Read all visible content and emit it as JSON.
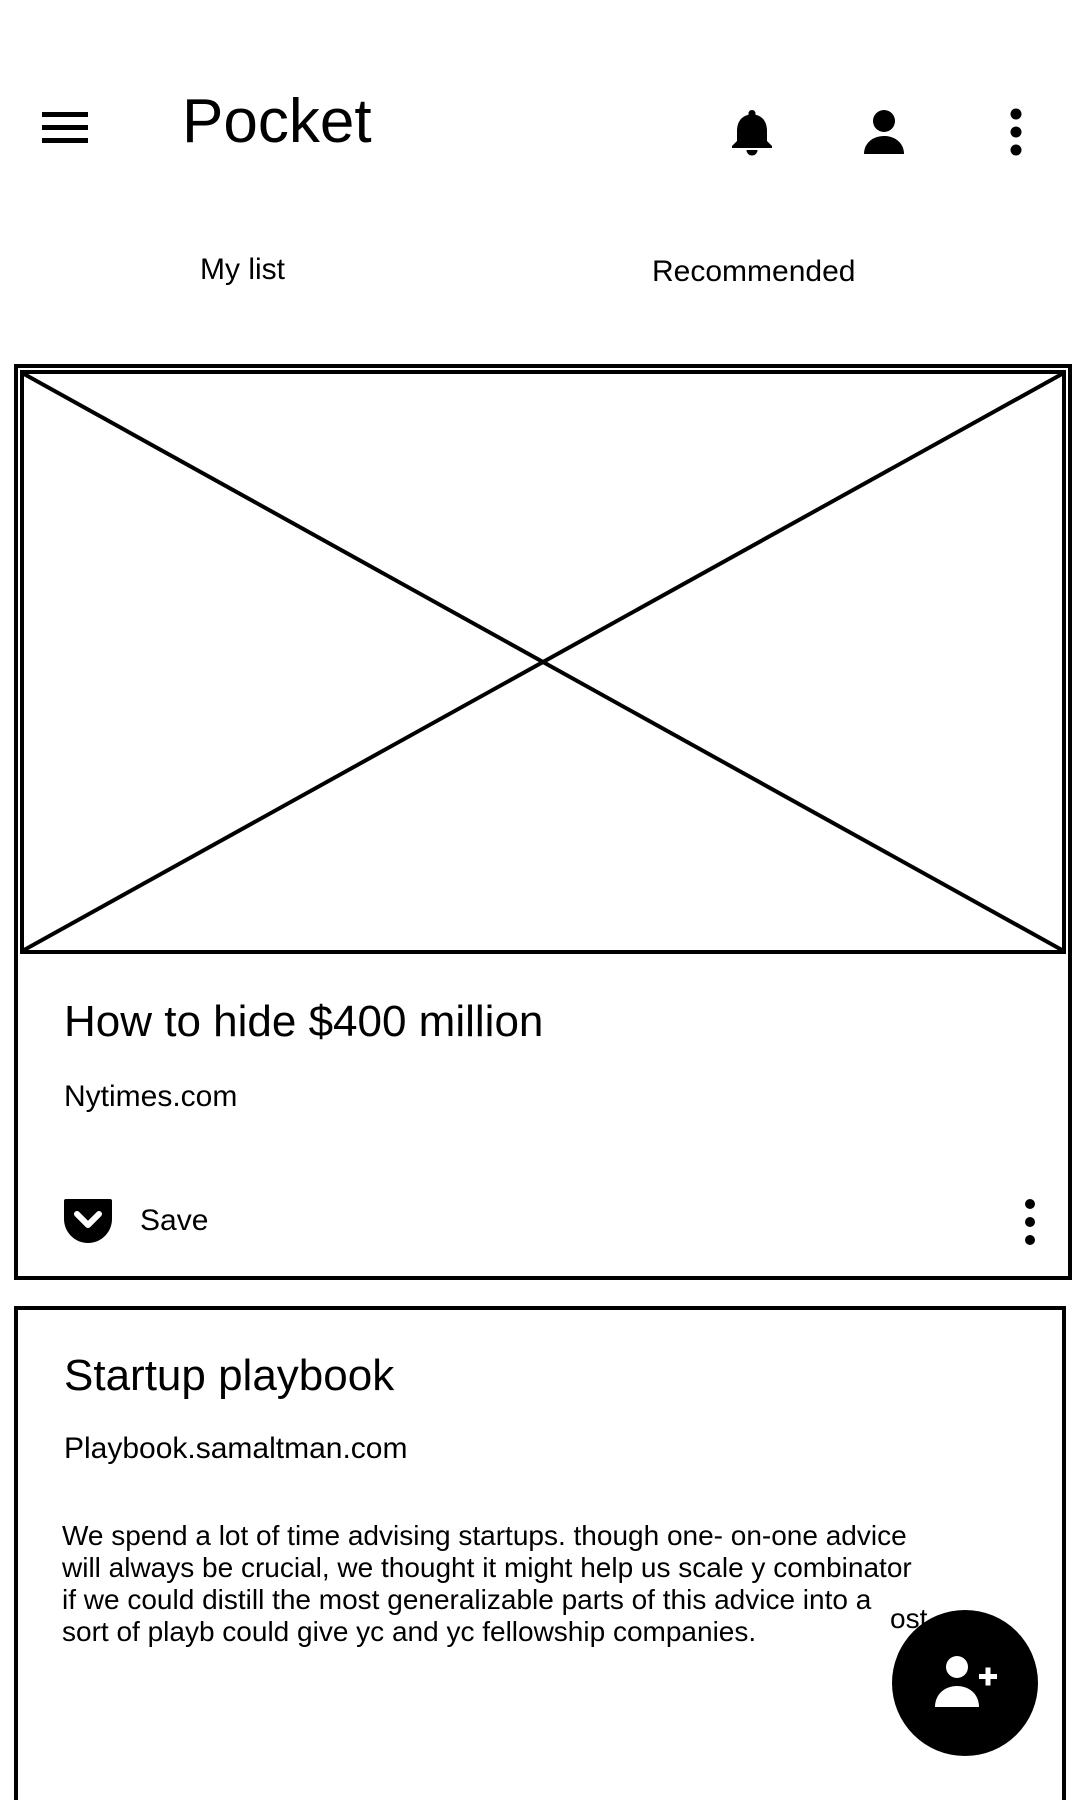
{
  "app": {
    "title": "Pocket"
  },
  "toolbar": {
    "icons": [
      "menu-icon",
      "bell-icon",
      "account-icon",
      "more-vert-icon"
    ]
  },
  "tabs": [
    {
      "label": "My list"
    },
    {
      "label": "Recommended"
    }
  ],
  "cards": [
    {
      "title": "How to hide $400 million",
      "source": "Nytimes.com",
      "has_thumbnail": true,
      "save_label": "Save"
    },
    {
      "title": "Startup playbook",
      "source": "Playbook.samaltman.com",
      "excerpt": "We spend a lot of time advising startups. though one- on-one advice will always be crucial, we thought it might help us scale y combinator if we could distill the most generalizable parts of this advice into a sort of playb could give yc and yc fellowship companies."
    }
  ],
  "fab": {
    "icon": "add-person-icon",
    "peek_text": "ost"
  },
  "colors": {
    "foreground": "#000000",
    "background": "#ffffff"
  }
}
